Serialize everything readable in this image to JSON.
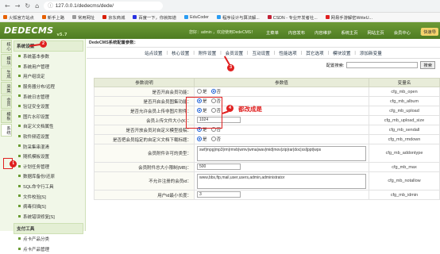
{
  "browser": {
    "back": "←",
    "forward": "→",
    "reload": "↻",
    "home": "⌂",
    "address": "127.0.0.1/dedecms/dede/"
  },
  "bookmarks": [
    {
      "label": "火狐官方站点",
      "color": "#e66000"
    },
    {
      "label": "新手上路",
      "color": "#e66000"
    },
    {
      "label": "常用网址",
      "color": "#999999"
    },
    {
      "label": "京东商城",
      "color": "#d81e06"
    },
    {
      "label": "百度一下，你就知道",
      "color": "#2932e1"
    },
    {
      "label": "EduCoder",
      "color": "#2b9cf2"
    },
    {
      "label": "程序设计与算法解...",
      "color": "#2b9cf2"
    },
    {
      "label": "CSDN - 专业开发者社...",
      "color": "#c32136"
    },
    {
      "label": "网易手游解密WriteU...",
      "color": "#e02020"
    }
  ],
  "header": {
    "logo": "DEDECMS",
    "version": "v5.7",
    "welcome": "您好：admin ，欢迎使用DedeCMS！",
    "nav": [
      "主菜单",
      "内容发布",
      "内容维护",
      "系统主页",
      "网站主页",
      "会员中心",
      "注销"
    ],
    "quick": "快速导"
  },
  "side_tabs": [
    "核心",
    "模块",
    "生成",
    "采集",
    "会员",
    "模板",
    "系统"
  ],
  "side_section": "系统设置",
  "side_items": [
    "系统基本参数",
    "系统用户管理",
    "用户组设定",
    "服务器分布/远程",
    "系统日志管理",
    "验证安全设置",
    "图片水印设置",
    "自定义文档属性",
    "软件频道设置",
    "防采集串混淆",
    "随机模板设置",
    "计划任务管理",
    "数据库备份/还原",
    "SQL命令行工具",
    "文件校验[S]",
    "病毒扫描[S]",
    "系统错误修复[S]"
  ],
  "side_section2": "支付工具",
  "side_items2": [
    "点卡产品分类",
    "点卡产品管理"
  ],
  "main": {
    "breadcrumb": "DedeCMS系统配置参数：",
    "tabs": [
      "站点设置",
      "核心设置",
      "附件设置",
      "会员设置",
      "互动设置",
      "性能选项",
      "其它选项",
      "模块设置",
      "添加新变量"
    ],
    "search_label": "配置搜索:",
    "search_button": "搜索",
    "col_desc": "参数说明",
    "col_value": "参数值",
    "col_var": "变量名",
    "yes": "是",
    "no": "否",
    "rows": [
      {
        "label": "是否开启会员功能：",
        "type": "radio",
        "value": "no",
        "var": "cfg_mb_open"
      },
      {
        "label": "是否开启会员图集功能：",
        "type": "radio",
        "value": "yes",
        "var": "cfg_mb_album"
      },
      {
        "label": "是否允许会员上传非图片附件：",
        "type": "radio",
        "value": "yes",
        "var": "cfg_mb_upload"
      },
      {
        "label": "会员上传文件大小(K)：",
        "type": "text",
        "value": "1024",
        "var": "cfg_mb_upload_size"
      },
      {
        "label": "是否开放会员对自定义模型投稿：",
        "type": "radio",
        "value": "yes",
        "var": "cfg_mb_sendall"
      },
      {
        "label": "是否把会员指定的自定义文档下载标题：",
        "type": "radio",
        "value": "yes",
        "var": "cfg_mb_rmdown"
      },
      {
        "label": "会员附件许可的类型：",
        "type": "area",
        "value": "swf|mpg|mp3|rm|rmvb|wmv|wma|wav|mid|mov|zip|rar|doc|xsl|ppt|wps",
        "var": "cfg_mb_addontype"
      },
      {
        "label": "会员附件总大小限制(MB)：",
        "type": "text",
        "value": "500",
        "var": "cfg_mb_max"
      },
      {
        "label": "不允许注册的会员id：",
        "type": "area",
        "value": "www,bbs,ftp,mail,user,users,admin,administrator",
        "var": "cfg_mb_notallow"
      },
      {
        "label": "用户id最小长度：",
        "type": "text",
        "value": "3",
        "var": "cfg_mb_idmin"
      }
    ]
  },
  "annotations": {
    "badges": [
      "1",
      "2",
      "3",
      "4"
    ],
    "note": "都改成是",
    "color": "#e02020"
  }
}
